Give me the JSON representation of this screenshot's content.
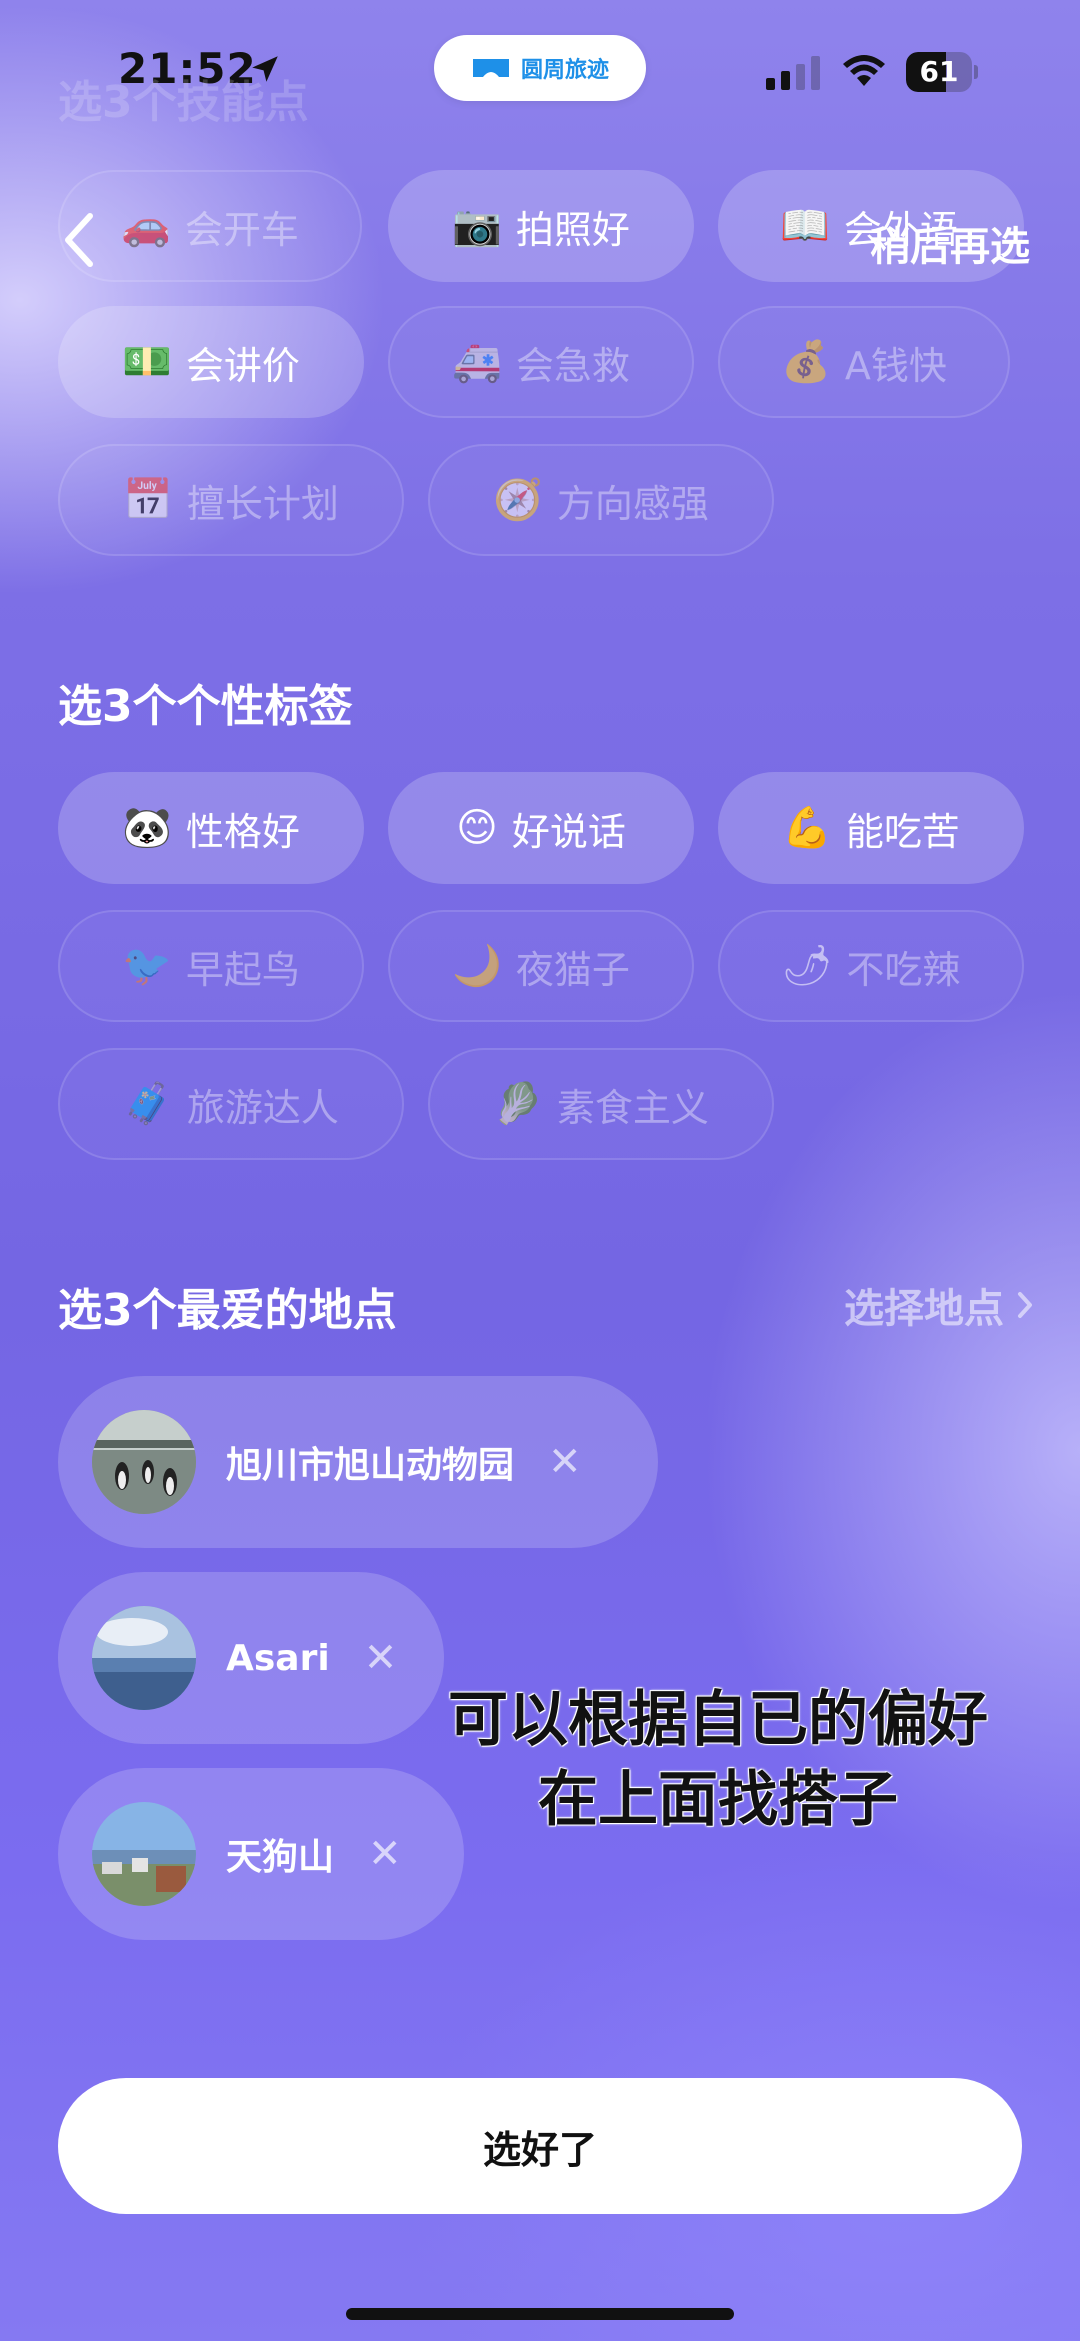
{
  "status_bar": {
    "time": "21:52",
    "island_brand": "圆周旅迹",
    "battery_level": "61",
    "battery_fraction": 0.61
  },
  "header": {
    "faded_title": "选3个技能点",
    "later_label": "稍后再选"
  },
  "skills": [
    {
      "emoji": "🚗",
      "label": "会开车",
      "selected": false
    },
    {
      "emoji": "📷",
      "label": "拍照好",
      "selected": true
    },
    {
      "emoji": "📖",
      "label": "会外语",
      "selected": true
    },
    {
      "emoji": "💵",
      "label": "会讲价",
      "selected": true
    },
    {
      "emoji": "🚑",
      "label": "会急救",
      "selected": false
    },
    {
      "emoji": "💰",
      "label": "A钱快",
      "selected": false
    },
    {
      "emoji": "📅",
      "label": "擅长计划",
      "selected": false
    },
    {
      "emoji": "🧭",
      "label": "方向感强",
      "selected": false
    }
  ],
  "personality": {
    "title": "选3个个性标签",
    "tags": [
      {
        "emoji": "🐼",
        "label": "性格好",
        "selected": true
      },
      {
        "emoji": "😊",
        "label": "好说话",
        "selected": true
      },
      {
        "emoji": "💪",
        "label": "能吃苦",
        "selected": true
      },
      {
        "emoji": "🐦",
        "label": "早起鸟",
        "selected": false
      },
      {
        "emoji": "🌙",
        "label": "夜猫子",
        "selected": false
      },
      {
        "emoji": "🌶",
        "label": "不吃辣",
        "selected": false
      },
      {
        "emoji": "🧳",
        "label": "旅游达人",
        "selected": false
      },
      {
        "emoji": "🥬",
        "label": "素食主义",
        "selected": false
      }
    ]
  },
  "places": {
    "title": "选3个最爱的地点",
    "select_label": "选择地点",
    "items": [
      {
        "name": "旭川市旭山动物园",
        "remove": "✕"
      },
      {
        "name": "Asari",
        "remove": "✕"
      },
      {
        "name": "天狗山",
        "remove": "✕"
      }
    ]
  },
  "overlay": {
    "line1": "可以根据自已的偏好",
    "line2": "在上面找搭子"
  },
  "confirm_label": "选好了",
  "colors": {
    "accent_blue": "#1e90e8",
    "background_purple": "#7466e3"
  }
}
